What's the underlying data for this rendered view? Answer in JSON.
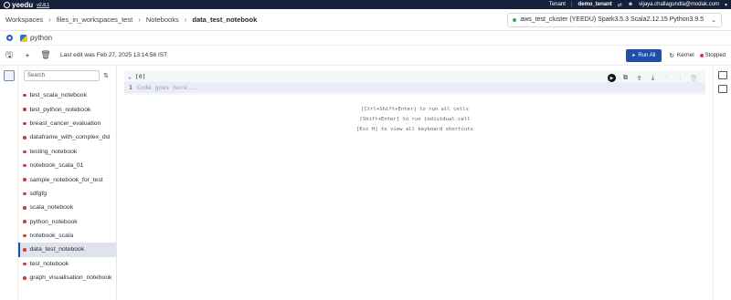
{
  "app": {
    "brand": "yeedu",
    "version": "v2.8.1",
    "tenant_label": "Tenant",
    "tenant_name": "demo_tenant",
    "user_email": "vijaya.challagundla@modak.com"
  },
  "breadcrumb": [
    "Workspaces",
    "files_in_workspaces_test",
    "Notebooks",
    "data_test_notebook"
  ],
  "cluster": {
    "label": "aws_test_cluster (YEEDU) Spark3.5.3 Scala2.12.15 Python3.9.5",
    "status_color": "#2bb24c"
  },
  "kernel_lang": "python",
  "toolbar": {
    "last_edit": "Last edit was Feb 27, 2025 13:14:56 IST",
    "run_all": "Run All",
    "kernel": "Kernel",
    "kernel_status": "Stopped"
  },
  "sidebar": {
    "search_placeholder": "Search",
    "notebooks": [
      "test_scala_notebook",
      "test_python_notebook",
      "breast_cancer_evaluation",
      "dataframe_with_complex_dsl",
      "testing_notebook",
      "notebook_scala_01",
      "sample_notebook_for_test",
      "sdfgfg",
      "scala_notebook",
      "python_notebook",
      "notebook_scala",
      "data_test_notebook",
      "test_notebook",
      "graph_visualisation_notebook"
    ],
    "active_notebook": "data_test_notebook"
  },
  "cell": {
    "execution_count": "[0]",
    "line_number": "1",
    "placeholder": "Code goes here..."
  },
  "hints": [
    "[Ctrl+Shift+Enter] to run all cells",
    "[Shift+Enter] to run individual cell",
    "[Esc H] to view all keyboard shortcuts"
  ]
}
